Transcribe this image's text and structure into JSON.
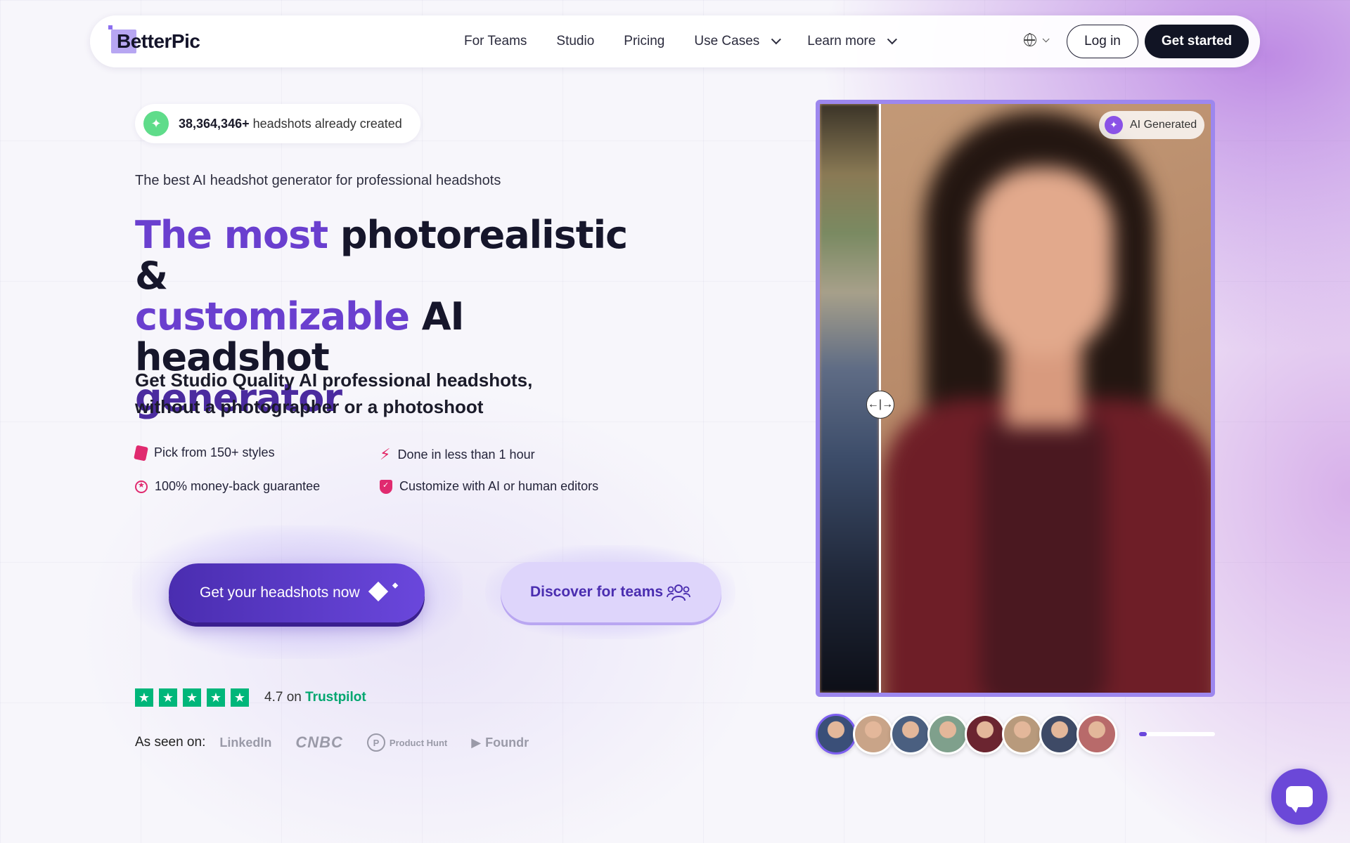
{
  "nav": {
    "logo": "BetterPic",
    "links": [
      "For Teams",
      "Studio",
      "Pricing",
      "Use Cases",
      "Learn more"
    ],
    "login": "Log in",
    "get_started": "Get started"
  },
  "hero": {
    "counter_number": "38,364,346+",
    "counter_suffix": "headshots already created",
    "subhead": "The best AI headshot generator for professional headshots",
    "title_part1": "The most photorealistic &",
    "title_part2": "customizable AI headshot",
    "title_part3": "generator",
    "description_line1": "Get Studio Quality AI professional headshots,",
    "description_line2": "without a photographer or a photoshoot",
    "features": [
      "Pick from 150+ styles",
      "Done in less than 1 hour",
      "100% money-back guarantee",
      "Customize with AI or human editors"
    ],
    "primary_cta": "Get your headshots now",
    "secondary_cta": "Discover for teams"
  },
  "trust": {
    "rating": "4.7",
    "on": "on",
    "brand": "Trustpilot",
    "stars": 5
  },
  "press": {
    "label": "As seen on:",
    "logos": [
      "LinkedIn",
      "CNBC",
      "Product Hunt",
      "Foundr"
    ]
  },
  "showcase": {
    "badge": "AI Generated",
    "thumb_colors": [
      "#3a4f78",
      "#c9a488",
      "#4a5f80",
      "#7fa08c",
      "#6b2530",
      "#b89a7c",
      "#3e4a66",
      "#b86a6a"
    ],
    "progress_fraction": 0.1
  },
  "colors": {
    "accent": "#6a47dc",
    "trustpilot": "#00b67a",
    "feature_icons": "#e02a6f"
  }
}
